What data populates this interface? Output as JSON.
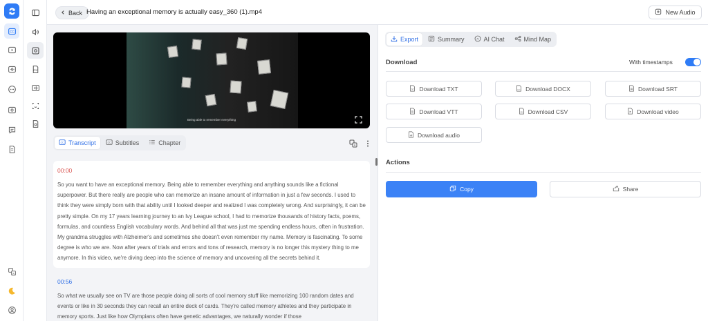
{
  "header": {
    "back_label": "Back",
    "file_name": "Having an exceptional memory is actually easy_360 (1).mp4",
    "new_audio_label": "New Audio"
  },
  "video": {
    "subtitle": "Being able to remember everything"
  },
  "left_tabs": [
    {
      "label": "Transcript",
      "icon": "cc-icon",
      "active": true
    },
    {
      "label": "Subtitles",
      "icon": "cc-icon",
      "active": false
    },
    {
      "label": "Chapter",
      "icon": "list-icon",
      "active": false
    }
  ],
  "transcript": [
    {
      "time": "00:00",
      "text": "So you want to have an exceptional memory. Being able to remember everything and anything sounds like a fictional superpower. But there really are people who can memorize an insane amount of information in just a few seconds. I used to think they were simply born with that ability until I looked deeper and realized I was completely wrong. And surprisingly, it can be pretty simple. On my 17 years learning journey to an Ivy League school, I had to memorize thousands of history facts, poems, formulas, and countless English vocabulary words. And behind all that was just me spending endless hours, often in frustration. My grandma struggles with Alzheimer's and sometimes she doesn't even remember my name. Memory is fascinating. To some degree is who we are. Now after years of trials and errors and tons of research, memory is no longer this mystery thing to me anymore. In this video, we're diving deep into the science of memory and uncovering all the secrets behind it."
    },
    {
      "time": "00:56",
      "text": "So what we usually see on TV are those people doing all sorts of cool memory stuff like memorizing 100 random dates and events or like in 30 seconds they can recall an entire deck of cards. They're called memory athletes and they participate in memory sports. Just like how Olympians often have genetic advantages, we naturally wonder if those"
    }
  ],
  "right_tabs": [
    {
      "label": "Export",
      "icon": "download-icon",
      "active": true
    },
    {
      "label": "Summary",
      "icon": "summary-icon",
      "active": false
    },
    {
      "label": "AI Chat",
      "icon": "ai-chat-icon",
      "active": false
    },
    {
      "label": "Mind Map",
      "icon": "mind-map-icon",
      "active": false
    }
  ],
  "download": {
    "title": "Download",
    "timestamps_label": "With timestamps",
    "timestamps_on": true,
    "buttons": [
      {
        "label": "Download TXT",
        "icon": "txt-file-icon"
      },
      {
        "label": "Download DOCX",
        "icon": "docx-file-icon"
      },
      {
        "label": "Download SRT",
        "icon": "srt-file-icon"
      },
      {
        "label": "Download VTT",
        "icon": "vtt-file-icon"
      },
      {
        "label": "Download CSV",
        "icon": "csv-file-icon"
      },
      {
        "label": "Download video",
        "icon": "video-file-icon"
      },
      {
        "label": "Download audio",
        "icon": "audio-file-icon"
      }
    ]
  },
  "actions": {
    "title": "Actions",
    "copy_label": "Copy",
    "share_label": "Share"
  },
  "colors": {
    "accent": "#2f7cf6",
    "copy_button": "#3b82f6",
    "timestamp_first": "#d9534f",
    "timestamp": "#2f6fe6"
  }
}
